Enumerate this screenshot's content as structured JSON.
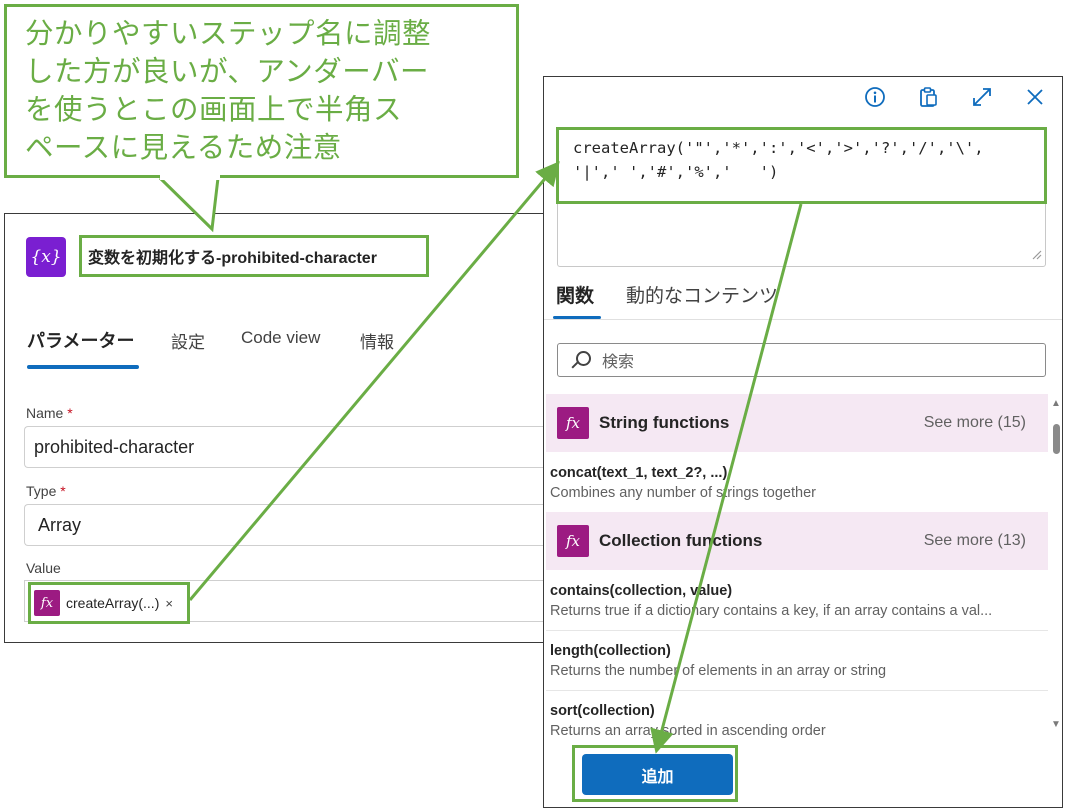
{
  "callout": {
    "lines": [
      "分かりやすいステップ名に調整",
      "した方が良いが、アンダーバー",
      "を使うとこの画面上で半角ス",
      "ペースに見えるため注意"
    ]
  },
  "action": {
    "icon_text": "{x}",
    "title": "変数を初期化する-prohibited-character",
    "tabs": [
      "パラメーター",
      "設定",
      "Code view",
      "情報"
    ]
  },
  "fields": {
    "name_label": "Name",
    "name_value": "prohibited-character",
    "type_label": "Type",
    "type_value": "Array",
    "value_label": "Value",
    "required_mark": "*",
    "token_text": "createArray(...)",
    "token_remove": "×"
  },
  "panel": {
    "expression_line1": "createArray('\"','*',':','<','>','?','/','\\',",
    "expression_line2": "'|',' ','#','%','   ')",
    "tabs": [
      "関数",
      "動的なコンテンツ"
    ],
    "search_placeholder": "検索",
    "categories": [
      {
        "name": "String functions",
        "see_more": "See more (15)"
      },
      {
        "name": "Collection functions",
        "see_more": "See more (13)"
      }
    ],
    "functions": [
      {
        "signature": "concat(text_1, text_2?, ...)",
        "description": "Combines any number of strings together"
      },
      {
        "signature": "contains(collection, value)",
        "description": "Returns true if a dictionary contains a key, if an array contains a val..."
      },
      {
        "signature": "length(collection)",
        "description": "Returns the number of elements in an array or string"
      },
      {
        "signature": "sort(collection)",
        "description": "Returns an array sorted in ascending order"
      }
    ],
    "add_button": "追加",
    "fx_glyph": "fx"
  },
  "colors": {
    "annotation_green": "#6aad45",
    "brand_blue": "#0f6cbd",
    "variable_purple": "#7a1fd1",
    "function_magenta": "#9c1b82",
    "category_bg": "#f5e8f3"
  },
  "icons": [
    "info-icon",
    "clipboard-icon",
    "expand-icon",
    "close-icon",
    "search-icon",
    "fx-icon",
    "variable-icon"
  ]
}
